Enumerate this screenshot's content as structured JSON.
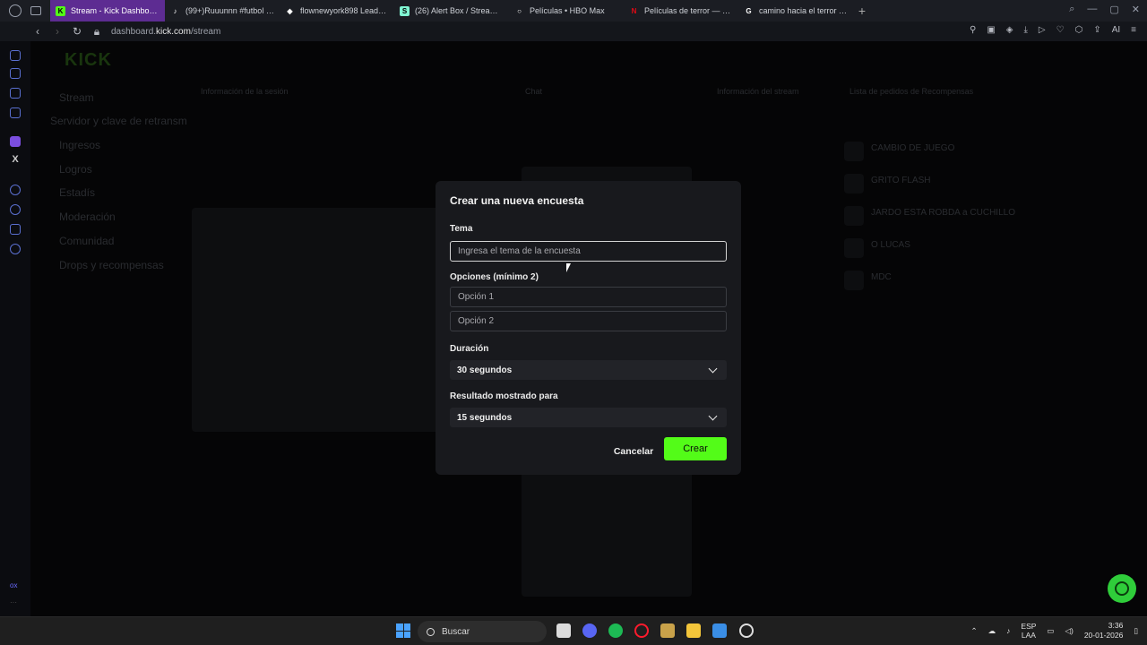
{
  "browser": {
    "tabs": [
      {
        "label": "Stream - Kick Dashboard",
        "color": "#53fc18",
        "active": true,
        "glyph": "K"
      },
      {
        "label": "(99+)Ruuunnn #futbol #ca",
        "color": "#ffffff",
        "active": false,
        "glyph": "♪"
      },
      {
        "label": "flownewyork898 LeaderB",
        "color": "#ffffff",
        "active": false,
        "glyph": "◆"
      },
      {
        "label": "(26) Alert Box / Streamlab",
        "color": "#80f5d2",
        "active": false,
        "glyph": "S"
      },
      {
        "label": "Películas • HBO Max",
        "color": "#ffffff",
        "active": false,
        "glyph": "○"
      },
      {
        "label": "Películas de terror — Netf",
        "color": "#e50914",
        "active": false,
        "glyph": "N"
      },
      {
        "label": "camino hacia el terror - Bu",
        "color": "#ffffff",
        "active": false,
        "glyph": "G"
      }
    ],
    "new_tab": "+",
    "url_prefix": "dashboard.",
    "url_domain": "kick.com",
    "url_path": "/stream",
    "toolbar_ai": "AI"
  },
  "opera_sidebar": {
    "label": "ox"
  },
  "background": {
    "logo": "KICK",
    "nav": [
      "Stream",
      "Servidor y clave de retransm",
      "Ingresos",
      "Logros",
      "Estadís",
      "Moderación",
      "Comunidad",
      "Drops y recompensas"
    ],
    "panels": [
      "Información de la sesión",
      "Chat",
      "Información del stream",
      "Lista de pedidos de Recompensas"
    ],
    "rewards": [
      "CAMBIO DE JUEGO",
      "GRITO FLASH",
      "JARDO ESTA ROBDA a CUCHILLO",
      "O LUCAS",
      "MDC"
    ]
  },
  "modal": {
    "title": "Crear una nueva encuesta",
    "topic_label": "Tema",
    "topic_placeholder": "Ingresa el tema de la encuesta",
    "options_label": "Opciones (mínimo 2)",
    "option1_placeholder": "Opción 1",
    "option2_placeholder": "Opción 2",
    "duration_label": "Duración",
    "duration_value": "30 segundos",
    "result_label": "Resultado mostrado para",
    "result_value": "15 segundos",
    "cancel_label": "Cancelar",
    "create_label": "Crear",
    "accent": "#53fc18"
  },
  "taskbar": {
    "search_label": "Buscar",
    "lang_top": "ESP",
    "lang_bottom": "LAA",
    "time": "3:36",
    "date": "20-01-2026"
  }
}
